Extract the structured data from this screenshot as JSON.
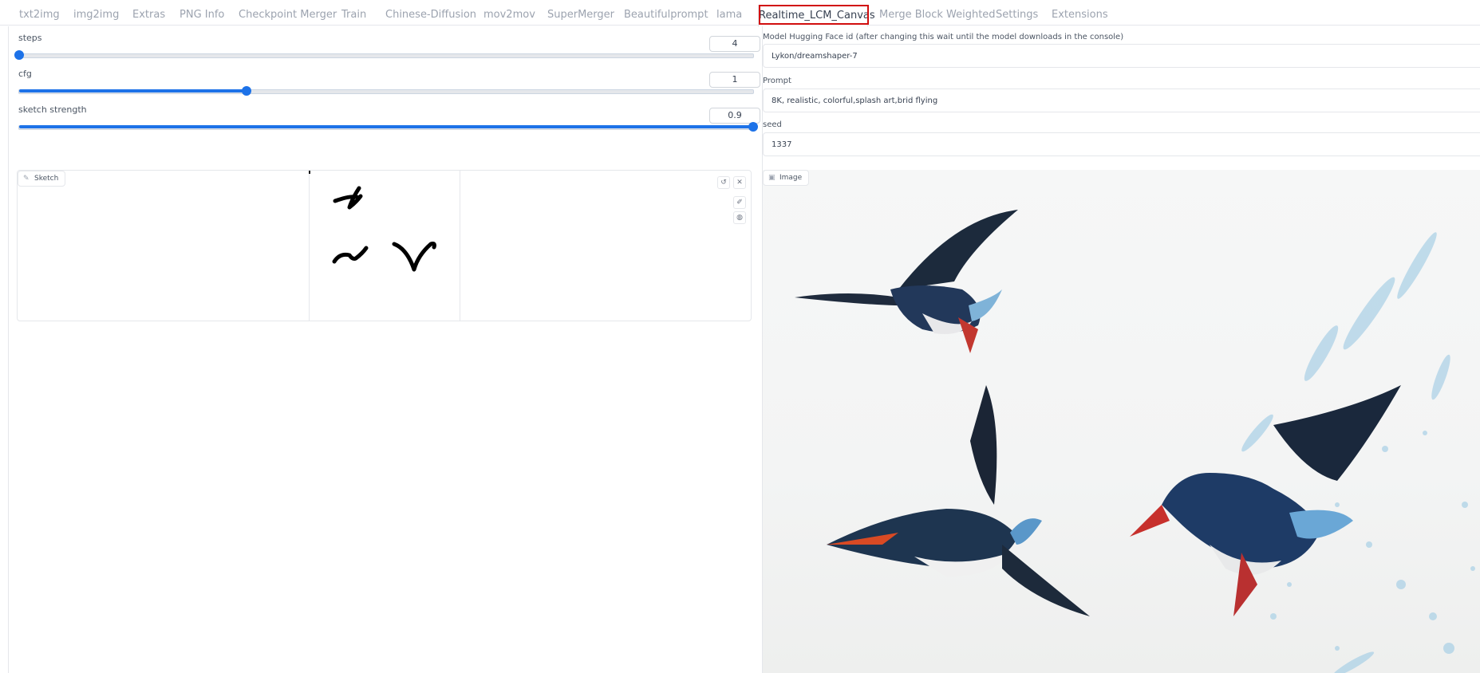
{
  "tabs": [
    {
      "label": "txt2img"
    },
    {
      "label": "img2img"
    },
    {
      "label": "Extras"
    },
    {
      "label": "PNG Info"
    },
    {
      "label": "Checkpoint Merger"
    },
    {
      "label": "Train"
    },
    {
      "label": "Chinese-Diffusion"
    },
    {
      "label": "mov2mov"
    },
    {
      "label": "SuperMerger"
    },
    {
      "label": "Beautifulprompt"
    },
    {
      "label": "lama"
    },
    {
      "label": "Realtime_LCM_Canvas"
    },
    {
      "label": "Merge Block Weighted"
    },
    {
      "label": "Settings"
    },
    {
      "label": "Extensions"
    }
  ],
  "active_tab": "Realtime_LCM_Canvas",
  "sliders": {
    "steps": {
      "label": "steps",
      "value": "4",
      "fraction": 0.0
    },
    "cfg": {
      "label": "cfg",
      "value": "1",
      "fraction": 0.31
    },
    "sketch_strength": {
      "label": "sketch strength",
      "value": "0.9",
      "fraction": 1.0
    }
  },
  "sketch": {
    "chip_label": "Sketch",
    "chip_icon": "pencil-icon"
  },
  "right": {
    "model_label": "Model Hugging Face id (after changing this wait until the model downloads in the console)",
    "model_value": "Lykon/dreamshaper-7",
    "prompt_label": "Prompt",
    "prompt_value": "8K, realistic, colorful,splash art,brid flying",
    "seed_label": "seed",
    "seed_value": "1337",
    "image_label": "Image",
    "image_icon": "image-icon"
  },
  "colors": {
    "accent": "#1d72e8",
    "active_tab_highlight": "#d10e0e"
  }
}
